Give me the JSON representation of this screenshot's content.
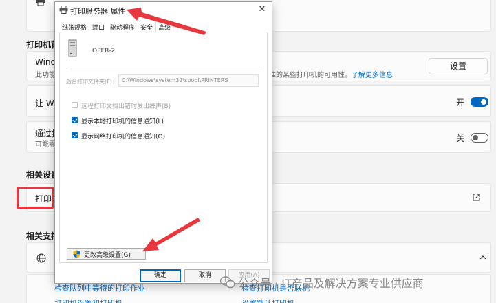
{
  "settings": {
    "section_printer_prefs": "打印机首",
    "row_windows": {
      "title": "Windo",
      "subtitle": "此功能",
      "sub_right": "安全标准的某些打印机的可用性。",
      "link": "了解更多信息",
      "button": "设置"
    },
    "row_let_windows": {
      "title": "让 Win",
      "toggle_label": "开",
      "toggle_state": "on"
    },
    "row_download": {
      "title": "通过按",
      "subtitle": "可能需要",
      "toggle_label": "关",
      "toggle_state": "off"
    },
    "section_related_settings": "相关设置",
    "row_print_server": {
      "title": "打印服",
      "icon": "external-link-icon"
    },
    "section_related_support": "相关支持",
    "row_help": {
      "icon": "globe-icon",
      "chevron": "chevron-up-icon",
      "link_left_1": "检查队列中等待的打印作业",
      "link_left_2": "打印机设置和打印机",
      "link_right_1": "检查打印机是否联机",
      "link_right_2": "设置默认打印机"
    }
  },
  "dialog": {
    "title": "打印服务器 属性",
    "tabs": [
      "纸张规格",
      "端口",
      "驱动程序",
      "安全",
      "高级"
    ],
    "active_tab": "高级",
    "server_name": "OPER-2",
    "spool_label": "后台打印文件夹(F):",
    "spool_path": "C:\\Windows\\system32\\spool\\PRINTERS",
    "options": [
      {
        "label": "远程打印文档出错时发出蜂声(B)",
        "checked": false,
        "disabled": true
      },
      {
        "label": "显示本地打印机的信息通知(L)",
        "checked": true,
        "disabled": false
      },
      {
        "label": "显示网络打印机的信息通知(O)",
        "checked": true,
        "disabled": false
      }
    ],
    "advanced_button": "更改高级设置(G)",
    "buttons": {
      "ok": "确定",
      "cancel": "取消",
      "apply": "应用(A)"
    }
  },
  "watermark": "公众号 · IT产品及解决方案专业供应商",
  "colors": {
    "accent": "#0067c0",
    "annotation": "#e8383d"
  }
}
